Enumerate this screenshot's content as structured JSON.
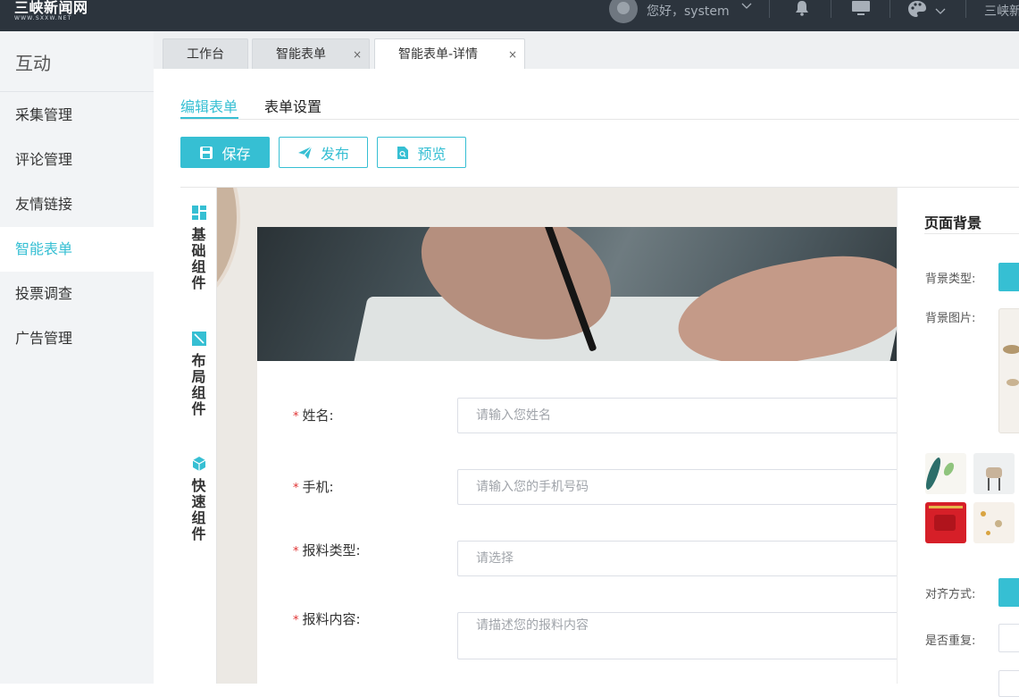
{
  "topbar": {
    "logo_title": "三峡新闻网",
    "logo_sub": "WWW.SXXW.NET",
    "greeting": "您好，system",
    "site_name": "三峡新",
    "icons": [
      "avatar",
      "chevron-down-icon",
      "bell-icon",
      "monitor-icon",
      "palette-icon",
      "chevron-down-icon"
    ]
  },
  "sidebar": {
    "title": "互动",
    "items": [
      {
        "label": "采集管理"
      },
      {
        "label": "评论管理"
      },
      {
        "label": "友情链接"
      },
      {
        "label": "智能表单",
        "active": true
      },
      {
        "label": "投票调查"
      },
      {
        "label": "广告管理"
      }
    ]
  },
  "tabs": [
    {
      "label": "工作台"
    },
    {
      "label": "智能表单",
      "closable": true
    },
    {
      "label": "智能表单-详情",
      "closable": true,
      "active": true
    }
  ],
  "close_glyph": "×",
  "subtabs": [
    {
      "label": "编辑表单",
      "active": true
    },
    {
      "label": "表单设置"
    }
  ],
  "toolbar": {
    "save": "保存",
    "publish": "发布",
    "preview": "预览"
  },
  "palette": {
    "groups": [
      {
        "chars": [
          "基",
          "础",
          "组",
          "件"
        ],
        "icon": "grid-icon"
      },
      {
        "chars": [
          "布",
          "局",
          "组",
          "件"
        ],
        "icon": "layout-icon"
      },
      {
        "chars": [
          "快",
          "速",
          "组",
          "件"
        ],
        "icon": "cube-icon"
      }
    ]
  },
  "form": {
    "required_mark": "*",
    "fields": [
      {
        "label": "姓名:",
        "placeholder": "请输入您姓名"
      },
      {
        "label": "手机:",
        "placeholder": "请输入您的手机号码"
      },
      {
        "label": "报料类型:",
        "placeholder": "请选择"
      },
      {
        "label": "报料内容:",
        "placeholder": "请描述您的报料内容"
      }
    ]
  },
  "right_panel": {
    "title": "页面背景",
    "bg_type_label": "背景类型:",
    "bg_image_label": "背景图片:",
    "align_label": "对齐方式:",
    "repeat_label": "是否重复:"
  },
  "colors": {
    "accent": "#36bfd3",
    "topbar": "#2c343d",
    "sidebar": "#f2f4f6",
    "required": "#e03131"
  }
}
